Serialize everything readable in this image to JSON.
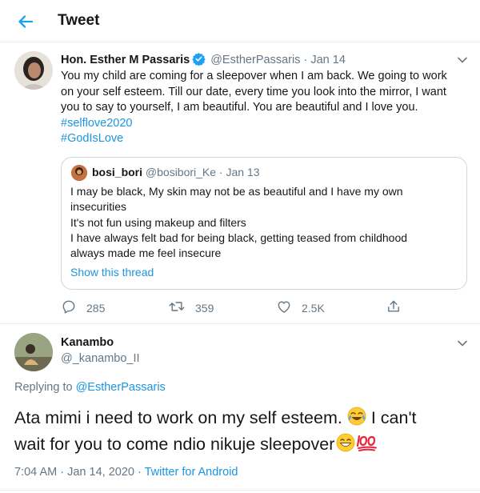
{
  "header": {
    "title": "Tweet",
    "back_icon": "back-arrow-icon",
    "accent": "#1da1f2"
  },
  "main_tweet": {
    "name": "Hon. Esther M Passaris",
    "handle": "@EstherPassaris",
    "separator": "·",
    "date": "Jan 14",
    "verified_icon": "verified-badge-icon",
    "text_lines": [
      "You my child are coming for a sleepover when I am back. We going to work",
      "on your self esteem. Till our date, every time you look into the mirror, I  want",
      "you to say to yourself, I am beautiful. You are beautiful and I love you."
    ],
    "hashtags": [
      "#selflove2020",
      "#GodIsLove"
    ],
    "quoted": {
      "name": "bosi_bori",
      "handle": "@bosibori_Ke",
      "date": "Jan 13",
      "text_lines": [
        "I may be black, My skin may not be as beautiful and I have my own",
        "insecurities",
        "It's not fun using makeup and filters",
        "I have always felt bad for being black, getting teased from childhood",
        "always made me feel insecure"
      ],
      "show_thread": "Show this thread"
    },
    "actions": {
      "replies": "285",
      "retweets": "359",
      "likes": "2.5K"
    }
  },
  "reply_tweet": {
    "name": "Kanambo",
    "handle": "@_kanambo_II",
    "replying_prefix": "Replying to",
    "replying_to": "@EstherPassaris",
    "line1": "Ata mimi i need to work on my self esteem.",
    "line1_end": "I can't",
    "line2": "wait for you to come ndio nikuje sleepover",
    "emoji_icons": [
      "face-with-tears-of-joy-icon",
      "grinning-face-icon",
      "hundred-points-icon"
    ],
    "time": "7:04 AM",
    "date": "Jan 14, 2020",
    "source": "Twitter for Android"
  }
}
